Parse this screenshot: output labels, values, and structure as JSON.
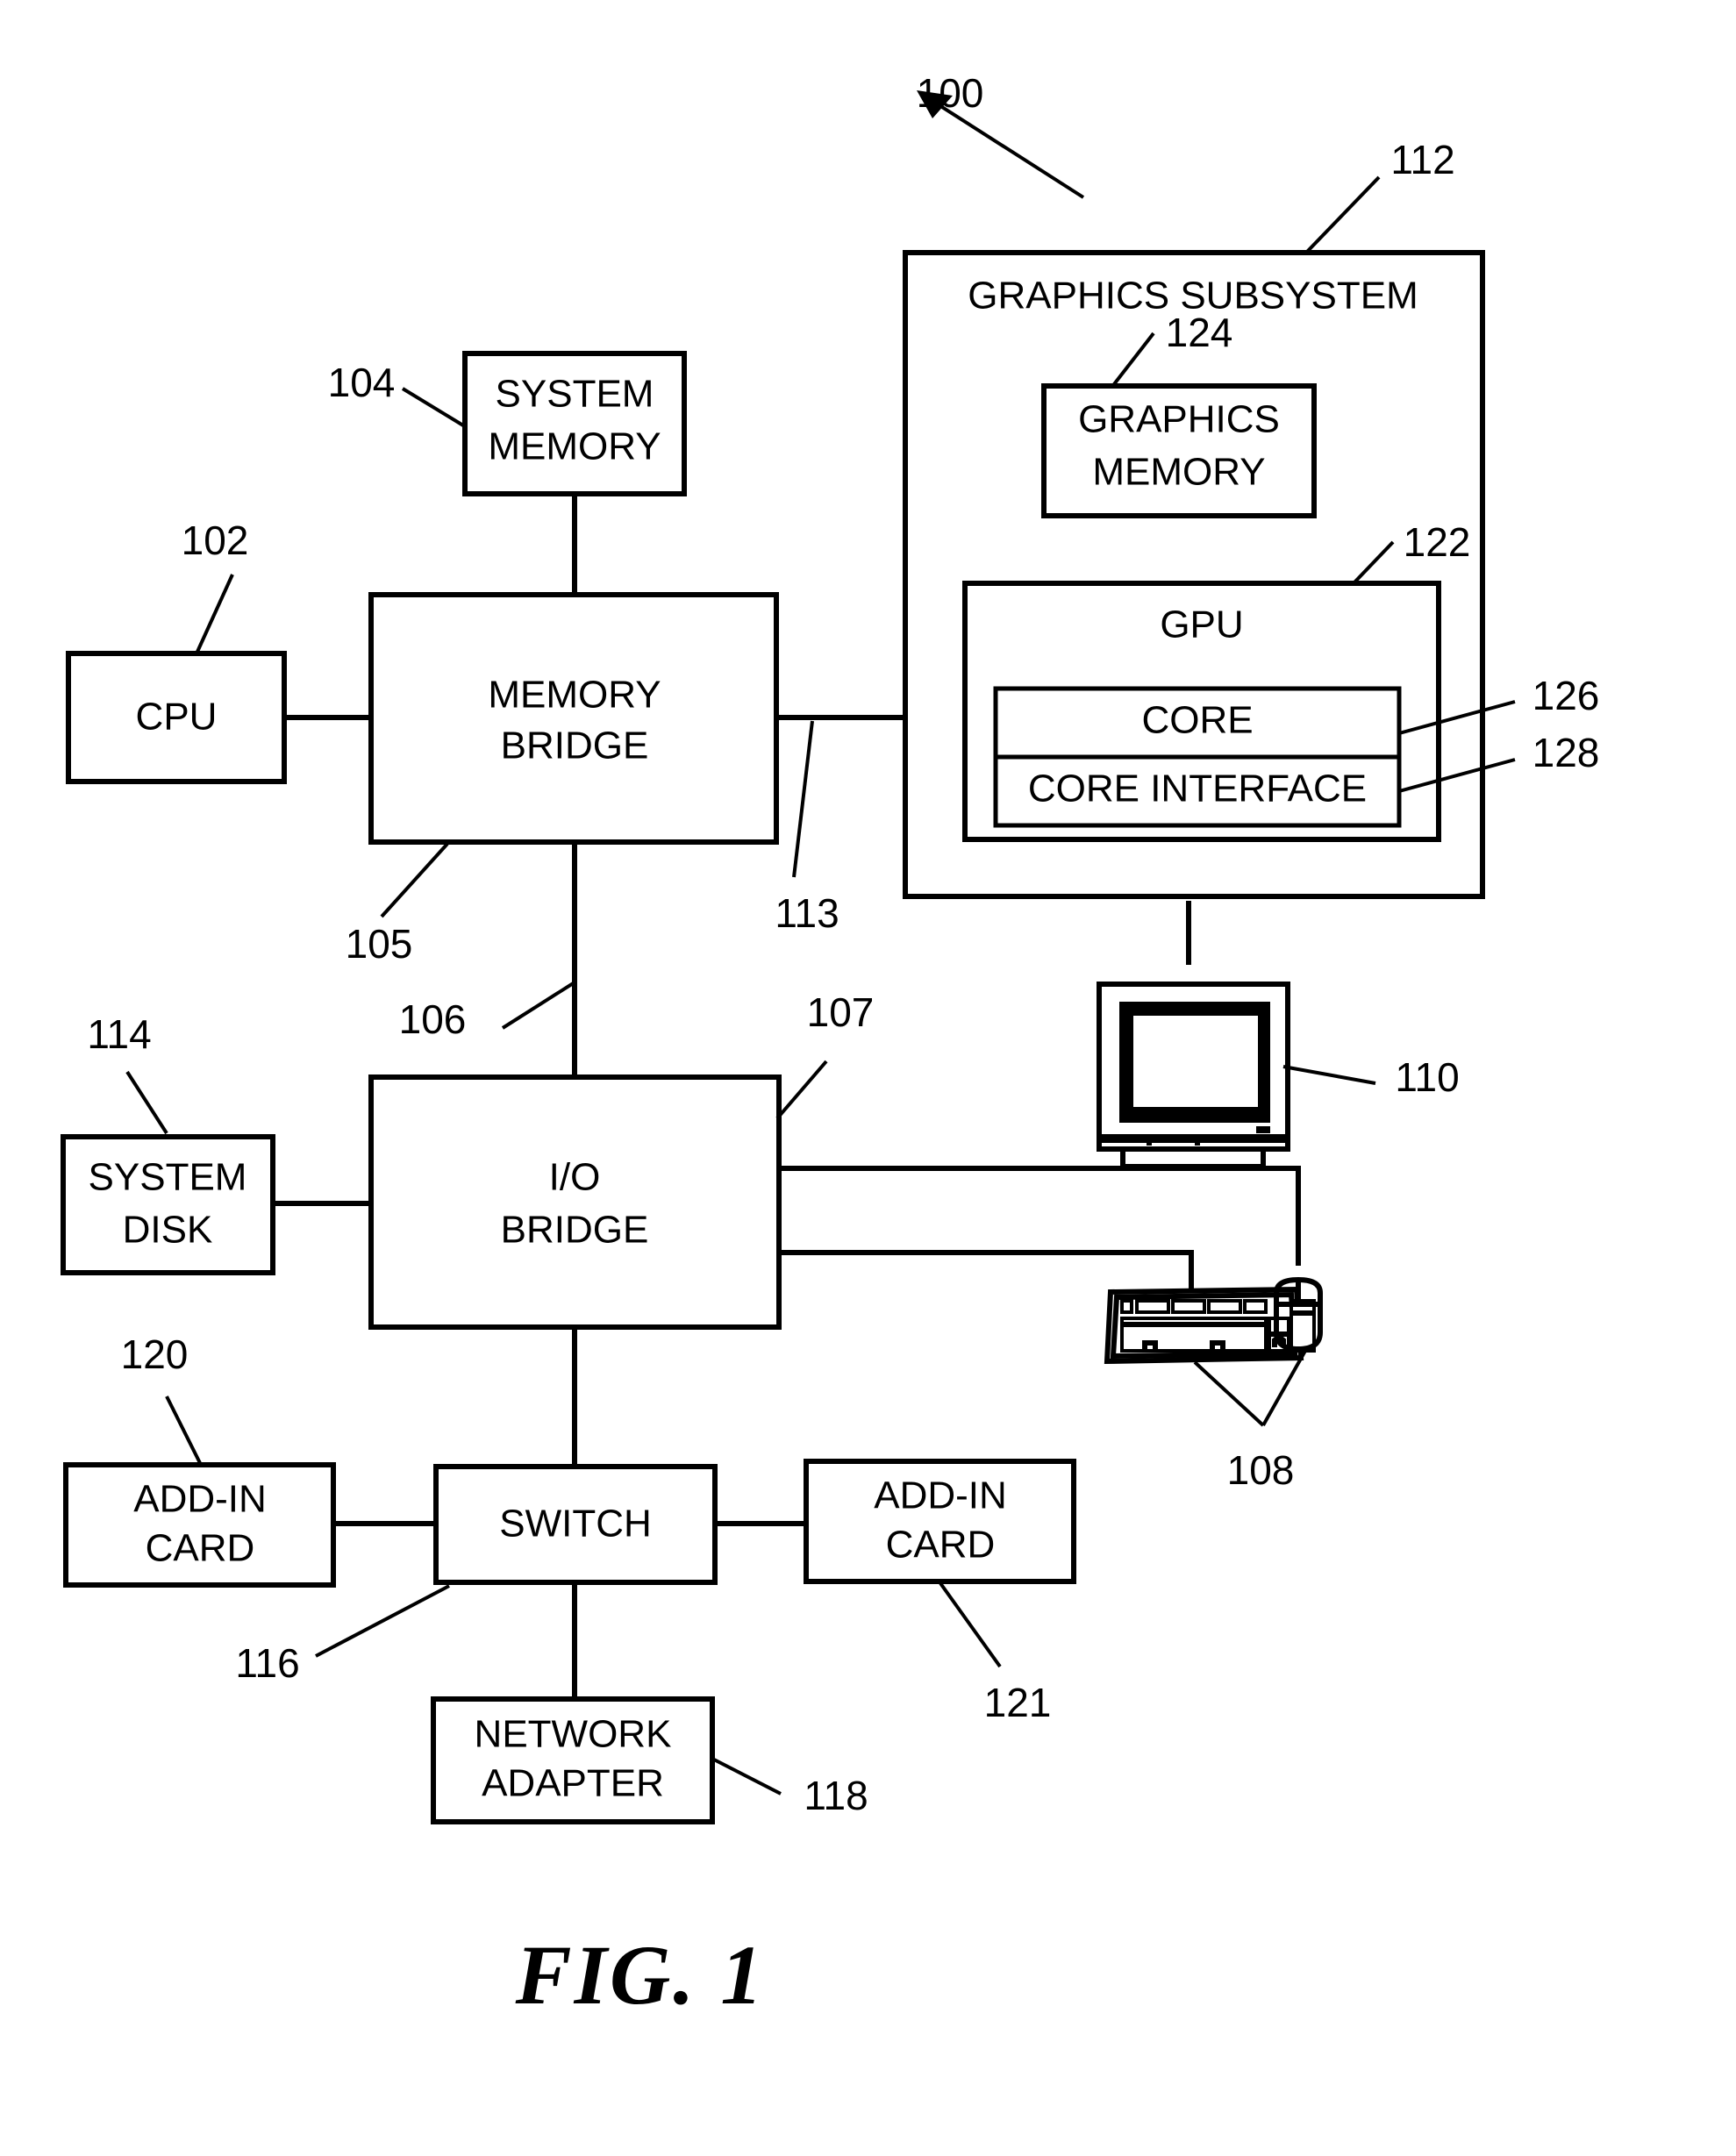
{
  "figure": {
    "caption": "FIG. 1",
    "system_ref": "100"
  },
  "blocks": {
    "cpu": {
      "label": "CPU",
      "ref": "102"
    },
    "system_memory": {
      "line1": "SYSTEM",
      "line2": "MEMORY",
      "ref": "104"
    },
    "memory_bridge": {
      "line1": "MEMORY",
      "line2": "BRIDGE",
      "ref": "105"
    },
    "io_bridge": {
      "line1": "I/O",
      "line2": "BRIDGE",
      "ref": "107"
    },
    "system_disk": {
      "line1": "SYSTEM",
      "line2": "DISK",
      "ref": "114"
    },
    "switch": {
      "label": "SWITCH",
      "ref": "116"
    },
    "add_in_card_left": {
      "line1": "ADD-IN",
      "line2": "CARD",
      "ref": "120"
    },
    "add_in_card_right": {
      "line1": "ADD-IN",
      "line2": "CARD",
      "ref": "121"
    },
    "network_adapter": {
      "line1": "NETWORK",
      "line2": "ADAPTER",
      "ref": "118"
    },
    "graphics_subsystem": {
      "label": "GRAPHICS SUBSYSTEM",
      "ref": "112"
    },
    "graphics_memory": {
      "line1": "GRAPHICS",
      "line2": "MEMORY",
      "ref": "124"
    },
    "gpu": {
      "label": "GPU",
      "ref": "122"
    },
    "core": {
      "label": "CORE",
      "ref": "126"
    },
    "core_interface": {
      "label": "CORE INTERFACE",
      "ref": "128"
    }
  },
  "devices": {
    "display": {
      "name": "display-monitor",
      "ref": "110"
    },
    "input_devices": {
      "name": "keyboard-and-mouse",
      "ref": "108"
    }
  },
  "connections": {
    "memory_bridge_to_io_bridge": {
      "ref": "106"
    },
    "memory_bridge_to_graphics_subsystem": {
      "ref": "113"
    }
  }
}
